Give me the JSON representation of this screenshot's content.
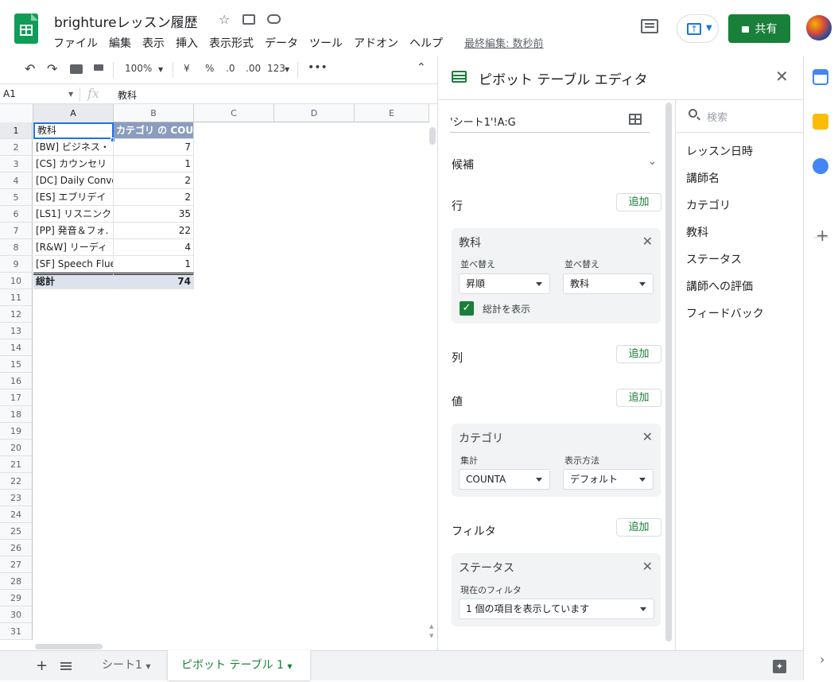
{
  "app": {
    "doc_title": "brightureレッスン履歴",
    "menu": [
      "ファイル",
      "編集",
      "表示",
      "挿入",
      "表示形式",
      "データ",
      "ツール",
      "アドオン",
      "ヘルプ"
    ],
    "last_edit": "最終編集: 数秒前",
    "share_label": "共有"
  },
  "toolbar": {
    "zoom": "100%",
    "currency": "¥",
    "percent": "%",
    "dec_decrease": ".0",
    "dec_increase": ".00",
    "format_more": "123"
  },
  "formula_bar": {
    "cell_ref": "A1",
    "fx": "fx",
    "content": "教科"
  },
  "sheet": {
    "columns": [
      "A",
      "B",
      "C",
      "D",
      "E"
    ],
    "row_numbers": [
      "1",
      "2",
      "3",
      "4",
      "5",
      "6",
      "7",
      "8",
      "9",
      "10",
      "11",
      "12",
      "13",
      "14",
      "15",
      "16",
      "17",
      "18",
      "19",
      "20",
      "21",
      "22",
      "23",
      "24",
      "25",
      "26",
      "27",
      "28",
      "29",
      "30",
      "31"
    ],
    "header": {
      "a": "教科",
      "b": "カテゴリ の COUNTA"
    },
    "rows": [
      {
        "a": "[BW] ビジネス・",
        "b": "7"
      },
      {
        "a": "[CS] カウンセリ",
        "b": "1"
      },
      {
        "a": "[DC] Daily Conve",
        "b": "2"
      },
      {
        "a": "[ES] エブリデイ",
        "b": "2"
      },
      {
        "a": "[LS1] リスニンク",
        "b": "35"
      },
      {
        "a": "[PP] 発音＆フォ.",
        "b": "22"
      },
      {
        "a": "[R&W] リーディ",
        "b": "4"
      },
      {
        "a": "[SF] Speech Flue",
        "b": "1"
      }
    ],
    "total": {
      "a": "総計",
      "b": "74"
    }
  },
  "tabs": {
    "sheet1": "シート1",
    "pivot": "ピボット テーブル 1"
  },
  "pivot_editor": {
    "title": "ピボット テーブル エディタ",
    "range": "'シート1'!A:G",
    "suggestions": "候補",
    "rows_label": "行",
    "columns_label": "列",
    "values_label": "値",
    "filters_label": "フィルタ",
    "add_label": "追加",
    "row_card": {
      "title": "教科",
      "sort_label": "並べ替え",
      "sort_by_label": "並べ替え",
      "sort_value": "昇順",
      "sort_by_value": "教科",
      "show_totals": "総計を表示"
    },
    "value_card": {
      "title": "カテゴリ",
      "summarize_label": "集計",
      "show_as_label": "表示方法",
      "summarize_value": "COUNTA",
      "show_as_value": "デフォルト"
    },
    "filter_card": {
      "title": "ステータス",
      "current_filter_label": "現在のフィルタ",
      "current_filter_value": "1 個の項目を表示しています"
    },
    "search_placeholder": "検索",
    "fields": [
      "レッスン日時",
      "講師名",
      "カテゴリ",
      "教科",
      "ステータス",
      "講師への評価",
      "フィードバック"
    ]
  },
  "colors": {
    "brand_green": "#188038",
    "header_fill": "#8b9dbf",
    "total_fill": "#dde3ed"
  }
}
